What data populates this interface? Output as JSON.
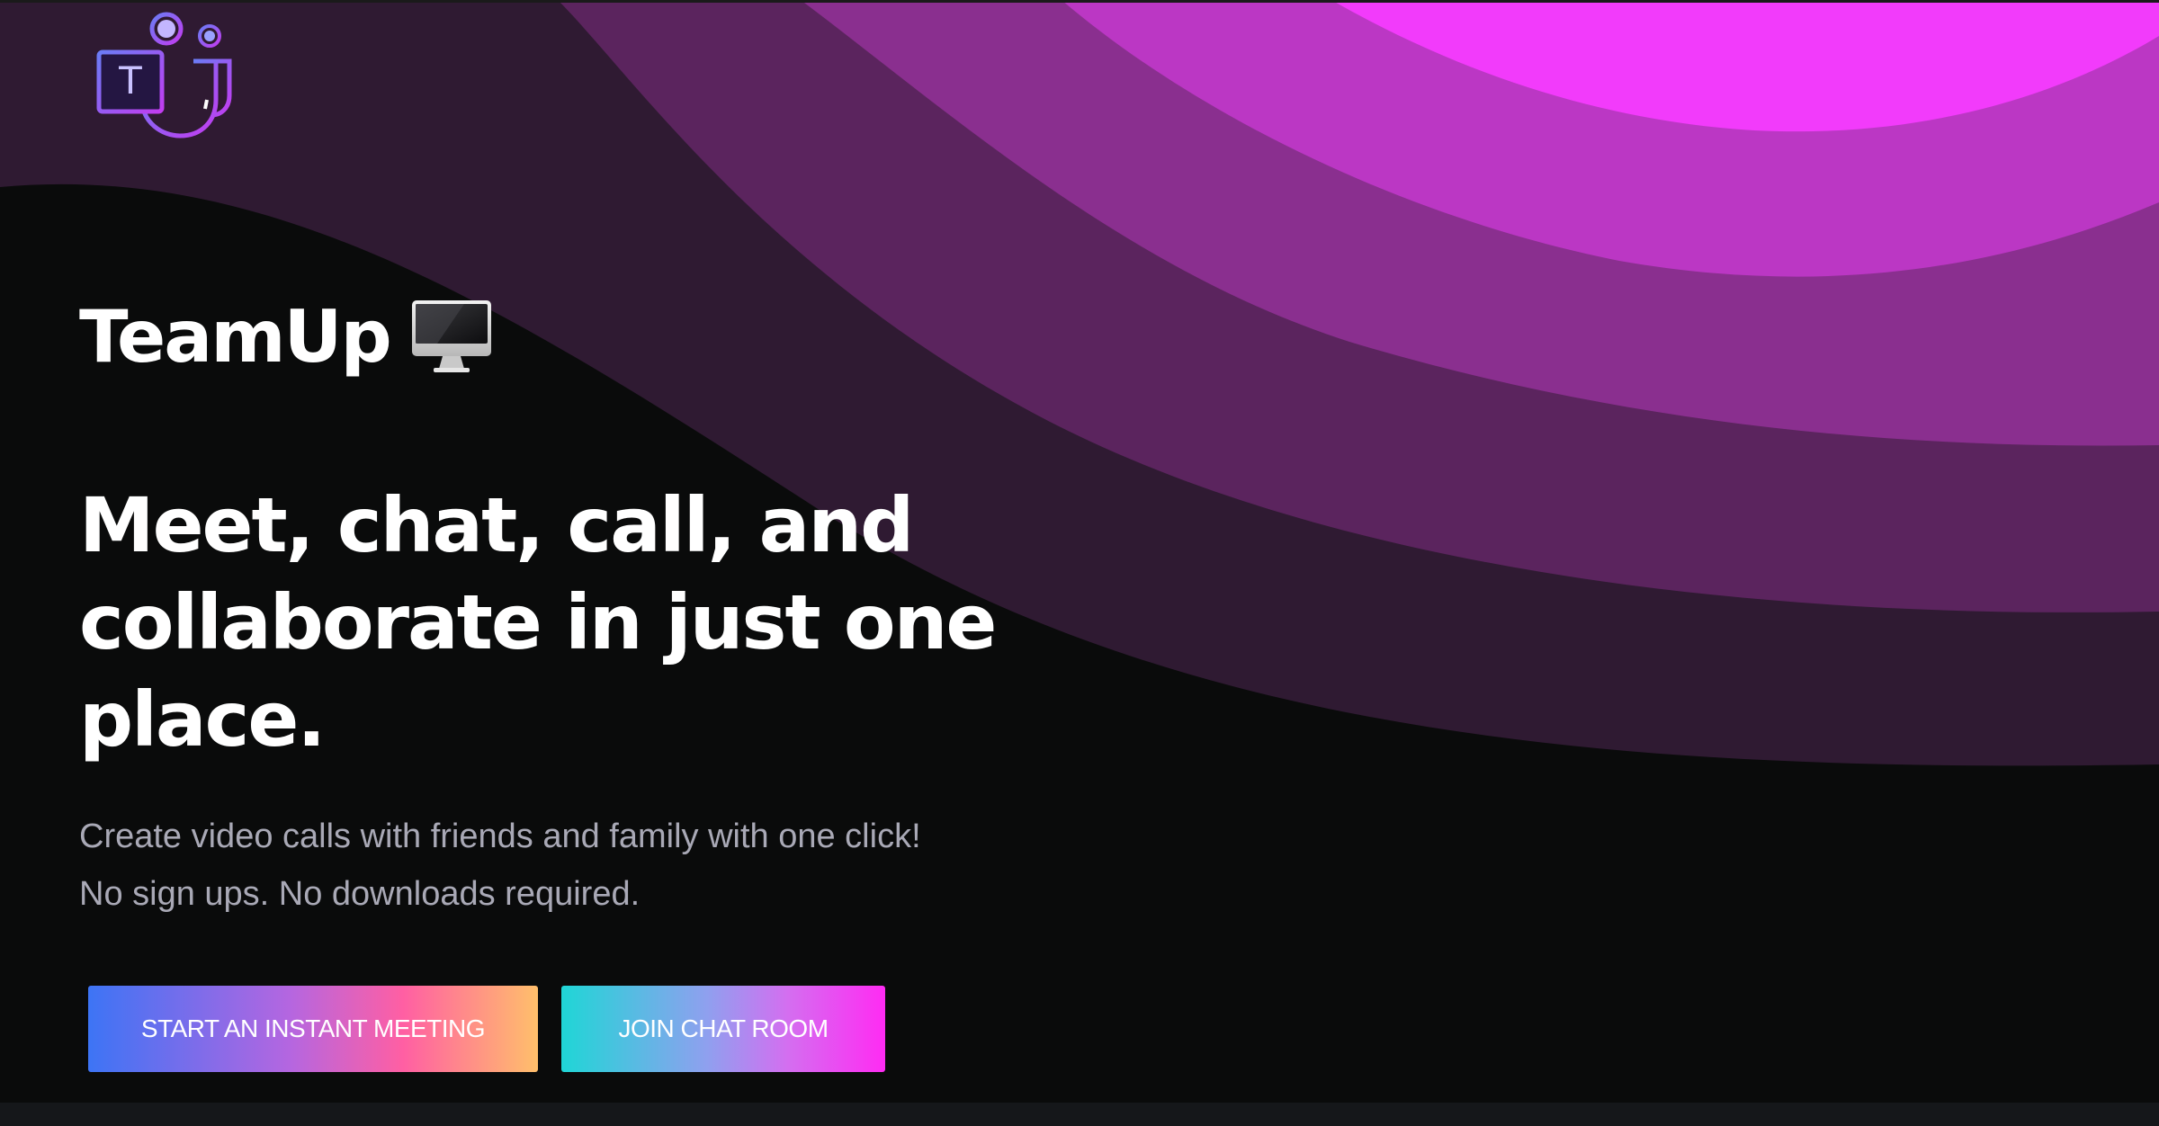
{
  "app": {
    "brand_name": "TeamUp",
    "brand_emoji_icon": "desktop-computer-icon",
    "logo_icon": "teams-logo-icon",
    "logo_letter": "T"
  },
  "hero": {
    "headline": "Meet, chat, call, and collaborate in just one place.",
    "subtext_line1": "Create video calls with friends and family with one click!",
    "subtext_line2": "No sign ups. No downloads required."
  },
  "buttons": {
    "start_meeting": "START AN INSTANT MEETING",
    "join_chat": "JOIN CHAT ROOM"
  },
  "colors": {
    "background": "#0a0b0b",
    "wave_1": "#2f1a32",
    "wave_2": "#5b245e",
    "wave_3": "#8a2f8f",
    "wave_4": "#bb37c4",
    "wave_5": "#f23bfb",
    "start_button_gradient": [
      "#3d74f5",
      "#b566e0",
      "#ff5fa3",
      "#ffbf6b"
    ],
    "join_button_gradient": [
      "#1fd6d6",
      "#8fa0ef",
      "#d46ef0",
      "#ff2bf3"
    ]
  }
}
